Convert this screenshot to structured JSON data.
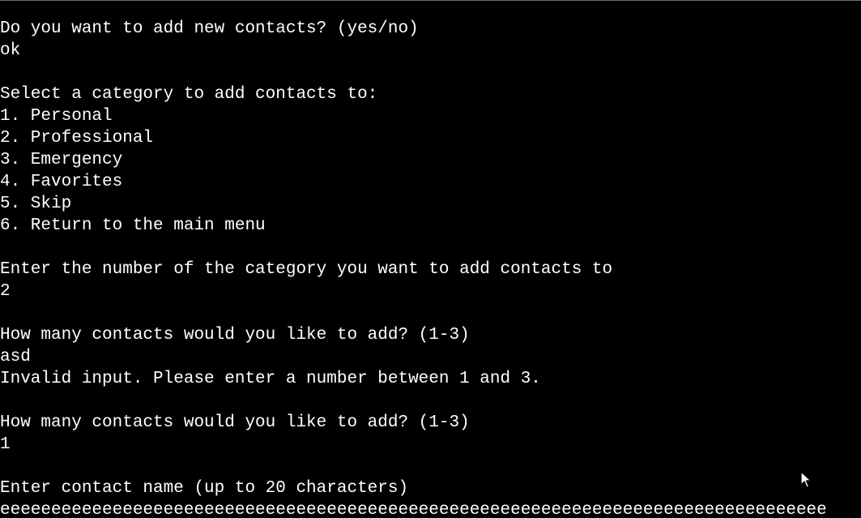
{
  "terminal": {
    "lines": [
      "Do you want to add new contacts? (yes/no)",
      "ok",
      "",
      "Select a category to add contacts to:",
      "1. Personal",
      "2. Professional",
      "3. Emergency",
      "4. Favorites",
      "5. Skip",
      "6. Return to the main menu",
      "",
      "Enter the number of the category you want to add contacts to",
      "2",
      "",
      "How many contacts would you like to add? (1-3)",
      "asd",
      "Invalid input. Please enter a number between 1 and 3.",
      "",
      "How many contacts would you like to add? (1-3)",
      "1",
      "",
      "Enter contact name (up to 20 characters)",
      "eeeeeeeeeeeeeeeeeeeeeeeeeeeeeeeeeeeeeeeeeeeeeeeeeeeeeeeeeeeeeeeeeeeeeeeeeeeeeeeee"
    ]
  },
  "colors": {
    "background": "#000000",
    "foreground": "#ffffff"
  },
  "icons": {
    "pointer": "mouse-pointer-icon"
  }
}
